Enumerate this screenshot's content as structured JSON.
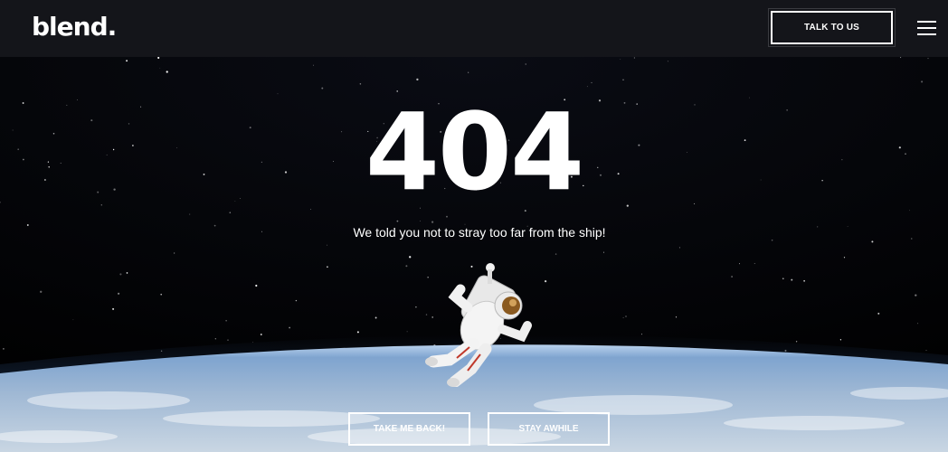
{
  "header": {
    "logo_text": "blend.",
    "cta_label": "TALK TO US",
    "menu_icon": "hamburger-icon"
  },
  "hero": {
    "error_code": "404",
    "message": "We told you not to stray too far from the ship!",
    "illustration": "astronaut-over-earth",
    "buttons": {
      "back_label": "TAKE ME BACK!",
      "stay_label": "STAY AWHILE"
    }
  },
  "colors": {
    "header_bg": "#14151a",
    "space_bg": "#010103",
    "text": "#ffffff",
    "earth_blue": "#8fb3d6"
  }
}
